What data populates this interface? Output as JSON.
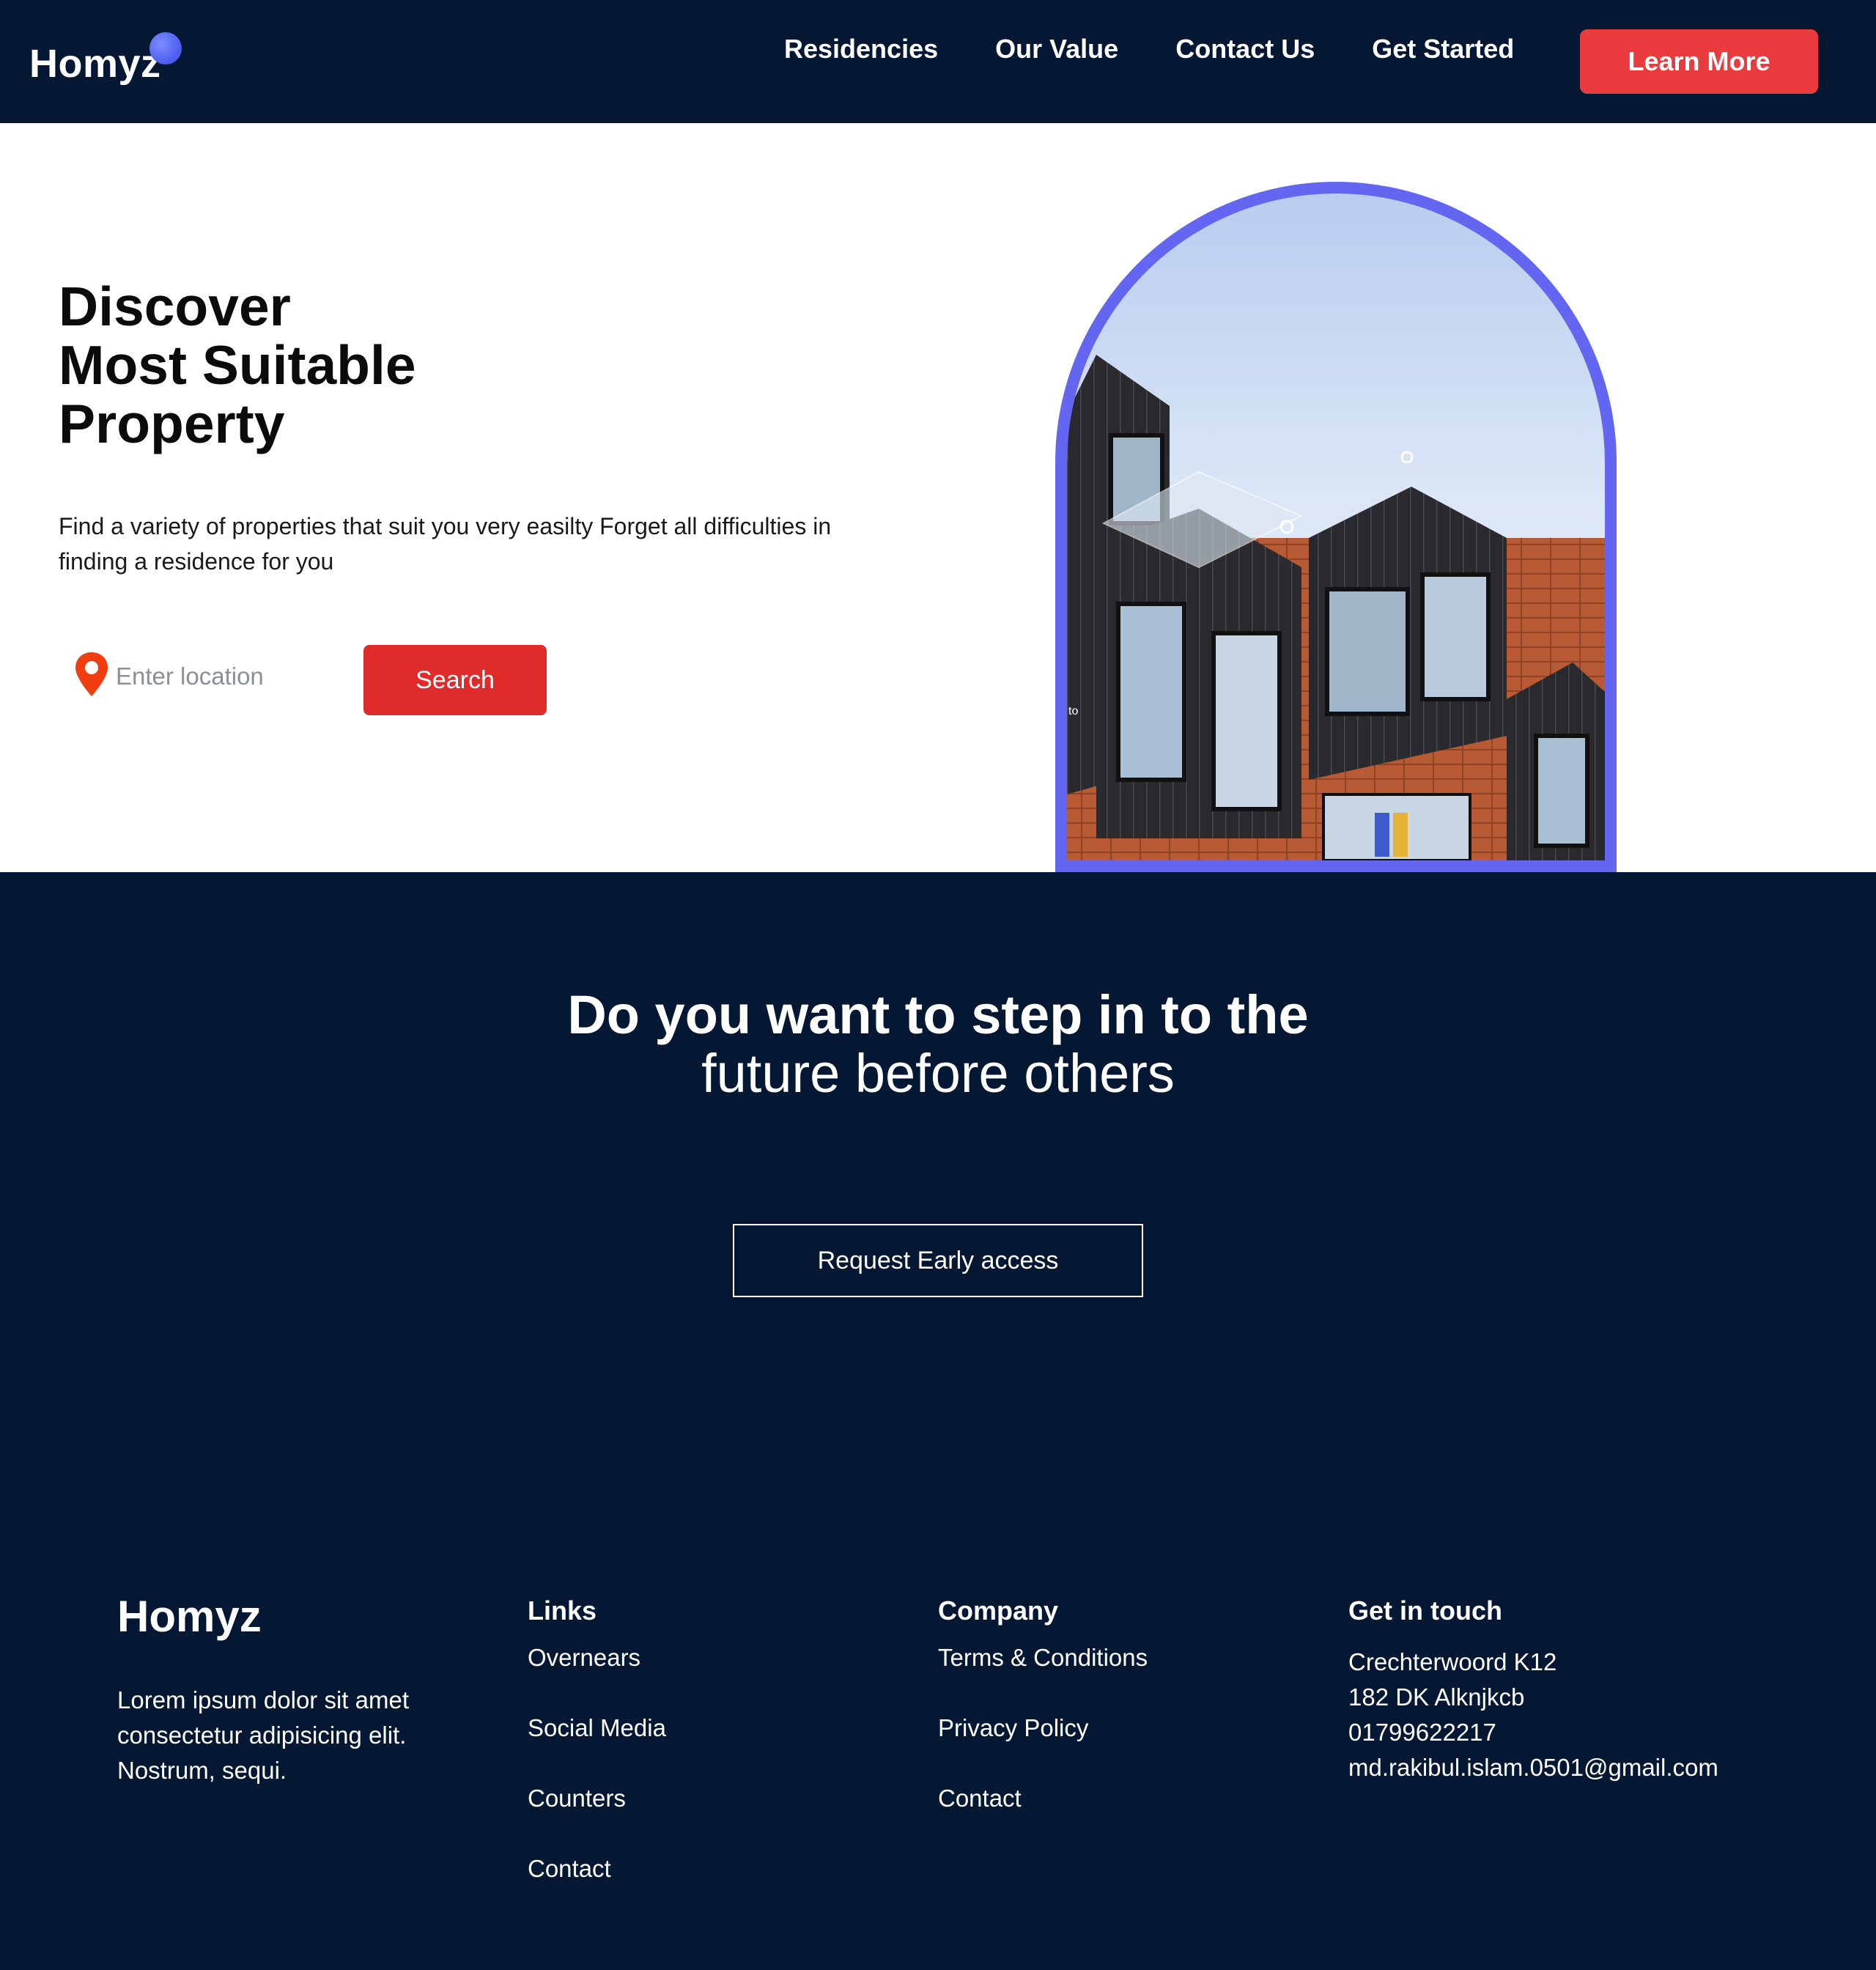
{
  "navbar": {
    "logo": "Homyz",
    "links": [
      "Residencies",
      "Our Value",
      "Contact Us",
      "Get Started"
    ],
    "cta": "Learn More"
  },
  "hero": {
    "title_lines": [
      "Discover",
      "Most Suitable",
      "Property"
    ],
    "description": "Find a variety of properties that suit you very easilty Forget all difficulties in finding a residence for you",
    "search": {
      "placeholder": "Enter location",
      "button": "Search"
    },
    "image_label": "to"
  },
  "cta": {
    "line1": "Do you want to step in to the",
    "line2": "future before others",
    "button": "Request Early access"
  },
  "footer": {
    "brand": "Homyz",
    "brand_description": "Lorem ipsum dolor sit amet consectetur adipisicing elit. Nostrum, sequi.",
    "links": {
      "heading": "Links",
      "items": [
        "Overnears",
        "Social Media",
        "Counters",
        "Contact"
      ]
    },
    "company": {
      "heading": "Company",
      "items": [
        "Terms & Conditions",
        "Privacy Policy",
        "Contact"
      ]
    },
    "contact": {
      "heading": "Get in touch",
      "lines": [
        "Crechterwoord K12",
        "182 DK Alknjkcb",
        "01799622217",
        "md.rakibul.islam.0501@gmail.com"
      ]
    }
  },
  "colors": {
    "navy": "#041833",
    "accent_red": "#ea3b3f",
    "arch_border": "#6366f1",
    "pin": "#f03d12"
  }
}
